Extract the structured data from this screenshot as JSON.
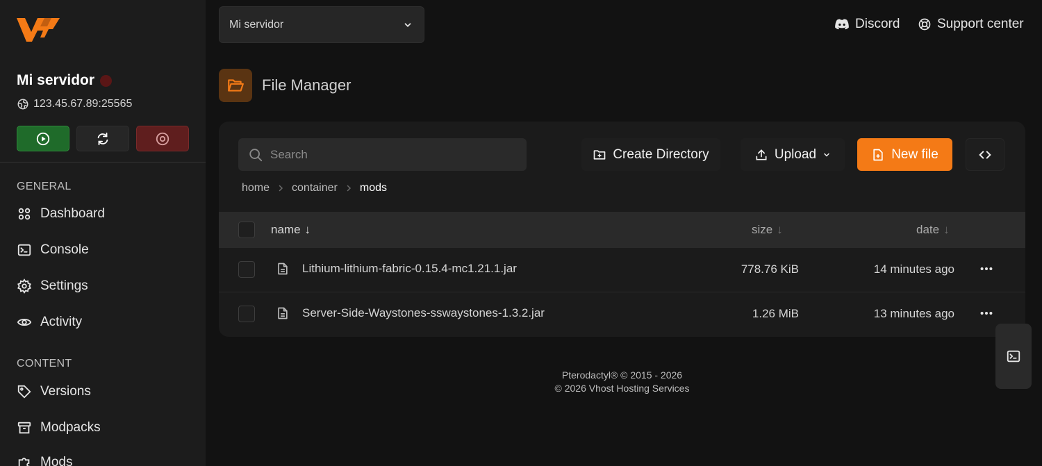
{
  "sidebar": {
    "server_name": "Mi servidor",
    "server_address": "123.45.67.89:25565",
    "sections": {
      "general": "GENERAL",
      "content": "CONTENT"
    },
    "nav": {
      "dashboard": "Dashboard",
      "console": "Console",
      "settings": "Settings",
      "activity": "Activity",
      "versions": "Versions",
      "modpacks": "Modpacks",
      "mods": "Mods"
    }
  },
  "topbar": {
    "server_select": "Mi servidor",
    "discord": "Discord",
    "support": "Support center"
  },
  "page": {
    "title": "File Manager"
  },
  "toolbar": {
    "search_placeholder": "Search",
    "create_directory": "Create Directory",
    "upload": "Upload",
    "new_file": "New file"
  },
  "breadcrumb": [
    "home",
    "container",
    "mods"
  ],
  "table": {
    "columns": {
      "name": "name",
      "size": "size",
      "date": "date"
    },
    "sort_arrow": "↓",
    "rows": [
      {
        "name": "Lithium-lithium-fabric-0.15.4-mc1.21.1.jar",
        "size": "778.76 KiB",
        "date": "14 minutes ago"
      },
      {
        "name": "Server-Side-Waystones-sswaystones-1.3.2.jar",
        "size": "1.26 MiB",
        "date": "13 minutes ago"
      }
    ]
  },
  "footer": {
    "line1": "Pterodactyl® © 2015 - 2026",
    "line2": "© 2026 Vhost Hosting Services"
  },
  "colors": {
    "accent": "#f47a16",
    "start": "#1f6b2a",
    "stop": "#5f1e1e",
    "status_offline": "#5a1616"
  }
}
